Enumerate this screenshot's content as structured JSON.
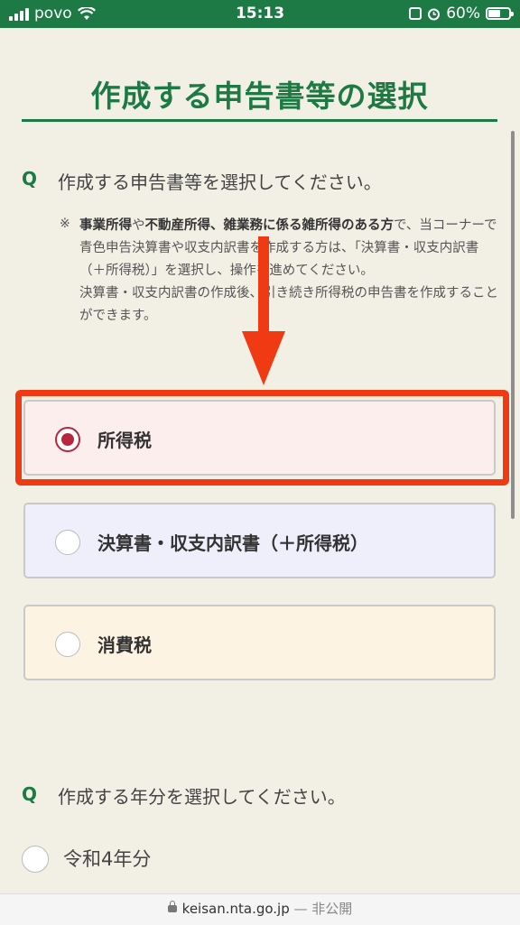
{
  "status_bar": {
    "carrier": "povo",
    "time": "15:13",
    "battery": "60%",
    "battery_level": 0.6
  },
  "page": {
    "title": "作成する申告書等の選択"
  },
  "question1": {
    "mark": "Q",
    "text": "作成する申告書等を選択してください。",
    "note_mark": "※",
    "note_bold1": "事業所得",
    "note_t1": "や",
    "note_bold2": "不動産所得、雑業務に係る雑所得のある方",
    "note_rest1": "で、当コーナーで青色申告決算書や収支内訳書を作成する方は、「決算書・収支内訳書（＋所得税）」を選択し、操作を進めてください。",
    "note_rest2": "決算書・収支内訳書の作成後、引き続き所得税の申告書を作成することができます。"
  },
  "options": [
    {
      "label": "所得税",
      "selected": true,
      "bg": "#fdeeee"
    },
    {
      "label": "決算書・収支内訳書（＋所得税）",
      "selected": false,
      "bg": "#efeffb"
    },
    {
      "label": "消費税",
      "selected": false,
      "bg": "#fdf3e2"
    }
  ],
  "question2": {
    "mark": "Q",
    "text": "作成する年分を選択してください。",
    "option": "令和4年分"
  },
  "url_bar": {
    "domain": "keisan.nta.go.jp",
    "suffix": "— 非公開"
  },
  "colors": {
    "brand_green": "#1e7a45",
    "highlight_red": "#f03a14",
    "radio_selected": "#b5283e"
  }
}
